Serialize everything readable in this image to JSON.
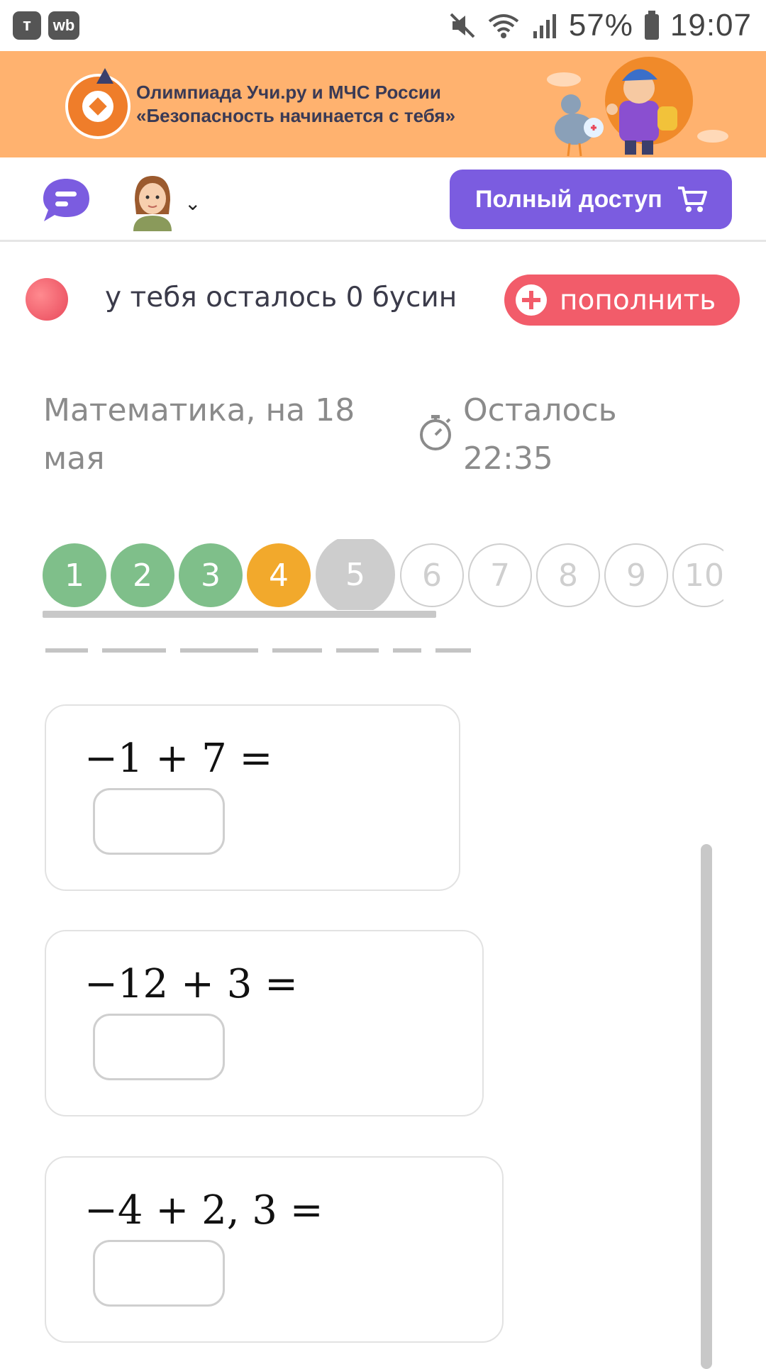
{
  "status_bar": {
    "left_app_1": "т",
    "left_app_2": "wb",
    "battery": "57%",
    "time": "19:07"
  },
  "banner": {
    "line1": "Олимпиада Учи.ру и МЧС России",
    "line2": "«Безопасность начинается с тебя»"
  },
  "header": {
    "full_access_label": "Полный доступ"
  },
  "beads": {
    "text": "у тебя осталось 0 бусин",
    "refill_label": "пополнить"
  },
  "lesson": {
    "subject": "Математика, на 18 мая",
    "timer_label": "Осталось 22:35"
  },
  "tasks": [
    {
      "label": "1",
      "state": "done"
    },
    {
      "label": "2",
      "state": "done"
    },
    {
      "label": "3",
      "state": "done"
    },
    {
      "label": "4",
      "state": "mid"
    },
    {
      "label": "5",
      "state": "cur"
    },
    {
      "label": "6",
      "state": "todo"
    },
    {
      "label": "7",
      "state": "todo"
    },
    {
      "label": "8",
      "state": "todo"
    },
    {
      "label": "9",
      "state": "todo"
    },
    {
      "label": "10",
      "state": "todo"
    }
  ],
  "exercises": [
    {
      "expression": "−1 + 7 =",
      "answer": ""
    },
    {
      "expression": "−12 + 3 =",
      "answer": ""
    },
    {
      "expression": "−4 + 2, 3 =",
      "answer": ""
    }
  ],
  "colors": {
    "banner_bg": "#ffb26f",
    "accent_purple": "#7b5ce0",
    "refill_red": "#f25c6a",
    "done_green": "#7fbf8a",
    "mid_orange": "#f2a92c"
  }
}
